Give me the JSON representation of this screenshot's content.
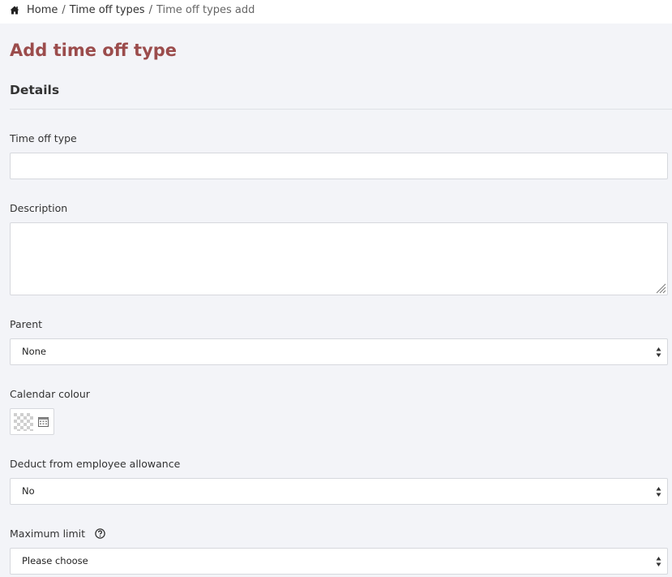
{
  "breadcrumb": {
    "home": "Home",
    "separator": "/",
    "level2": "Time off types",
    "current": "Time off types add"
  },
  "page": {
    "title": "Add time off type",
    "section_title": "Details"
  },
  "form": {
    "time_off_type": {
      "label": "Time off type",
      "value": "",
      "placeholder": ""
    },
    "description": {
      "label": "Description",
      "value": ""
    },
    "parent": {
      "label": "Parent",
      "selected": "None"
    },
    "calendar_colour": {
      "label": "Calendar colour",
      "value": "transparent"
    },
    "deduct": {
      "label": "Deduct from employee allowance",
      "selected": "No"
    },
    "maximum_limit": {
      "label": "Maximum limit",
      "selected": "Please choose"
    }
  },
  "colors": {
    "title_accent": "#9b4c4c",
    "page_background": "#f3f4f8",
    "border": "#d6d8dd"
  },
  "icons": [
    "home-icon",
    "resize-handle-icon",
    "select-arrows-icon",
    "calendar-icon",
    "help-icon"
  ]
}
